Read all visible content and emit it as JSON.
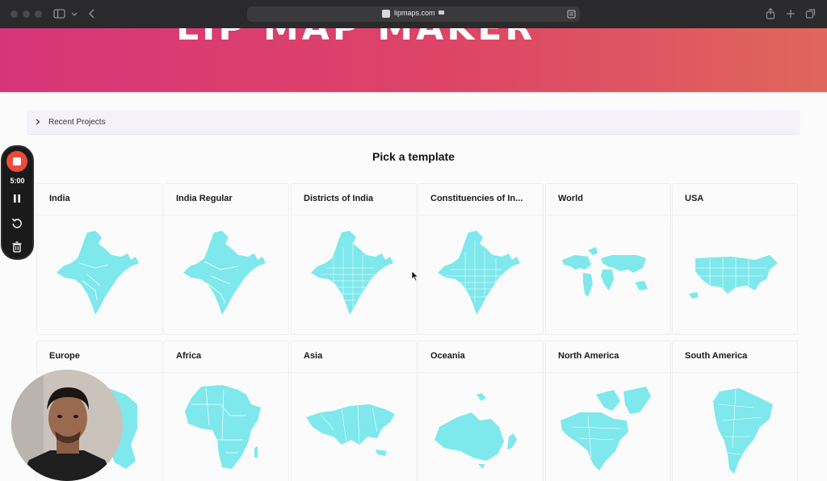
{
  "browser": {
    "url": "lipmaps.com",
    "icons": [
      "window-dot",
      "sidebar-icon",
      "chevron-down-icon",
      "back-icon",
      "lock-icon",
      "reader-icon",
      "share-icon",
      "new-tab-icon",
      "tabs-overview-icon"
    ]
  },
  "hero": {
    "title": "LIP MAP MAKER"
  },
  "recent": {
    "label": "Recent Projects"
  },
  "section": {
    "title": "Pick a template"
  },
  "templates": [
    {
      "name": "India"
    },
    {
      "name": "India Regular"
    },
    {
      "name": "Districts of India"
    },
    {
      "name": "Constituencies of In..."
    },
    {
      "name": "World"
    },
    {
      "name": "USA"
    },
    {
      "name": "Europe"
    },
    {
      "name": "Africa"
    },
    {
      "name": "Asia"
    },
    {
      "name": "Oceania"
    },
    {
      "name": "North America"
    },
    {
      "name": "South America"
    }
  ],
  "recorder": {
    "time": "5:00"
  },
  "colors": {
    "map_fill": "#7ee8ec",
    "hero_start": "#d73579",
    "hero_end": "#e0665c",
    "record_red": "#ec4b3c"
  }
}
